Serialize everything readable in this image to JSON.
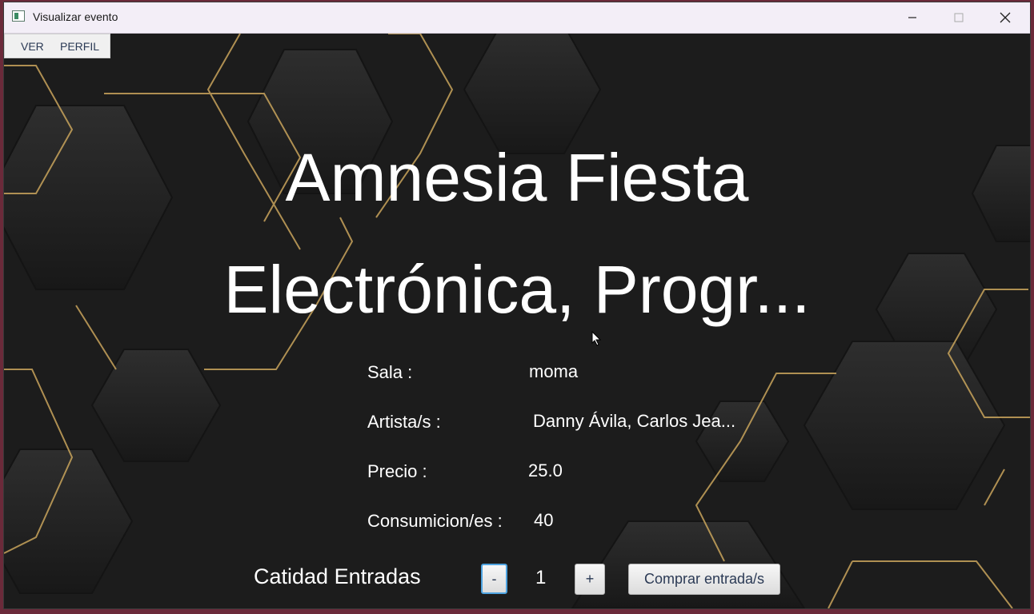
{
  "window": {
    "title": "Visualizar evento",
    "controls": {
      "minimize": "minimize-icon",
      "maximize": "maximize-icon",
      "close": "close-icon"
    }
  },
  "menu": {
    "items": [
      {
        "label": "VER"
      },
      {
        "label": "PERFIL"
      }
    ]
  },
  "event": {
    "title_line1": "Amnesia Fiesta",
    "title_line2": "Electrónica, Progr...",
    "fields": {
      "sala": {
        "label": "Sala :",
        "value": "moma"
      },
      "artistas": {
        "label": "Artista/s :",
        "value": "Danny Ávila, Carlos Jea..."
      },
      "precio": {
        "label": "Precio :",
        "value": "25.0"
      },
      "consumiciones": {
        "label": "Consumicion/es :",
        "value": "40"
      }
    }
  },
  "tickets": {
    "label": "Catidad Entradas",
    "decrement_label": "-",
    "quantity": "1",
    "increment_label": "+",
    "buy_label": "Comprar entrada/s"
  },
  "colors": {
    "background": "#1d1d1d",
    "accent_gold": "#c9a45c",
    "text": "#ffffff"
  }
}
